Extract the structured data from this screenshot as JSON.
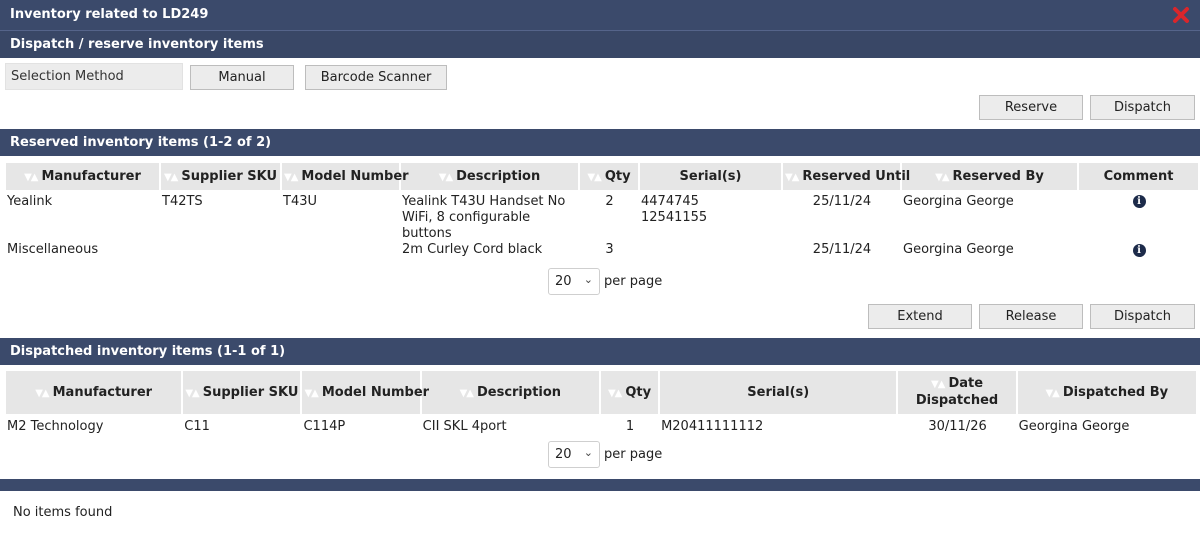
{
  "window": {
    "title": "Inventory related to LD249"
  },
  "dispatch_section": {
    "title": "Dispatch / reserve inventory items",
    "selection_method_label": "Selection Method",
    "manual_label": "Manual",
    "barcode_label": "Barcode Scanner",
    "reserve_label": "Reserve",
    "dispatch_label": "Dispatch"
  },
  "reserved": {
    "title": "Reserved inventory items  (1-2 of 2)",
    "columns": [
      "Manufacturer",
      "Supplier SKU",
      "Model Number",
      "Description",
      "Qty",
      "Serial(s)",
      "Reserved Until",
      "Reserved By",
      "Comment"
    ],
    "rows": [
      {
        "manufacturer": "Yealink",
        "supplier_sku": "T42TS",
        "model_number": "T43U",
        "description_1": "Yealink T43U Handset No",
        "description_2": "WiFi, 8 configurable buttons",
        "qty": "2",
        "serial_1": "4474745",
        "serial_2": "12541155",
        "reserved_until": "25/11/24",
        "reserved_by": "Georgina George"
      },
      {
        "manufacturer": "Miscellaneous",
        "supplier_sku": "",
        "model_number": "",
        "description_1": "2m Curley Cord black",
        "description_2": "",
        "qty": "3",
        "serial_1": "",
        "serial_2": "",
        "reserved_until": "25/11/24",
        "reserved_by": "Georgina George"
      }
    ],
    "per_page_value": "20",
    "per_page_label": "per page",
    "extend_label": "Extend",
    "release_label": "Release",
    "dispatch_label": "Dispatch"
  },
  "dispatched": {
    "title": "Dispatched inventory items  (1-1 of 1)",
    "columns": [
      "Manufacturer",
      "Supplier SKU",
      "Model Number",
      "Description",
      "Qty",
      "Serial(s)",
      "Date",
      "Dispatched",
      "Dispatched By"
    ],
    "rows": [
      {
        "manufacturer": "M2 Technology",
        "supplier_sku": "C11",
        "model_number": "C114P",
        "description": "CII SKL 4port",
        "qty": "1",
        "serial": "M20411111112",
        "date_dispatched": "30/11/26",
        "dispatched_by": "Georgina George"
      }
    ],
    "per_page_value": "20",
    "per_page_label": "per page"
  },
  "empty_section": {
    "message": "No items found"
  },
  "icons": {
    "close": "close-icon",
    "info": "info-icon",
    "sort": "sort-arrows-icon",
    "chevron": "chevron-down-icon"
  },
  "colors": {
    "header_bar": "#3b4a6b",
    "close_red": "#d9262b",
    "button_bg": "#ececec",
    "table_header_bg": "#e6e6e6"
  }
}
